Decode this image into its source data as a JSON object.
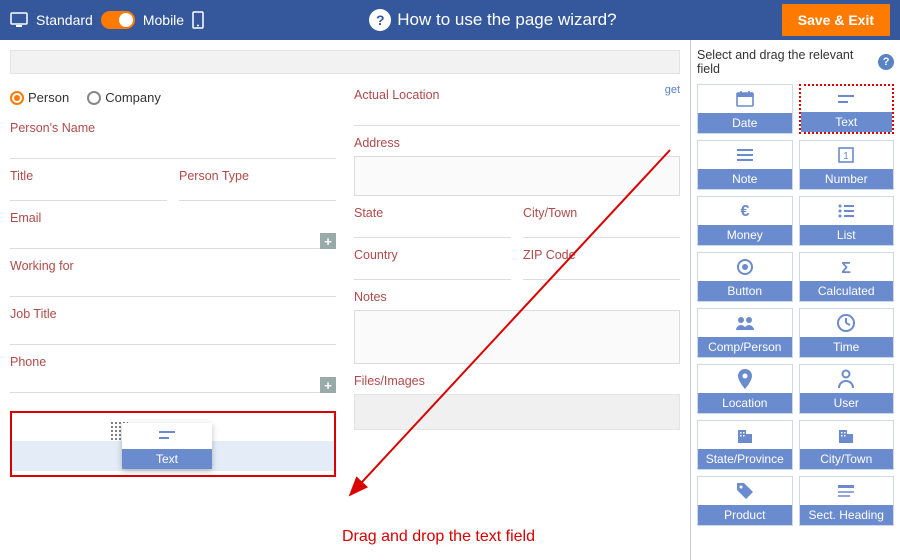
{
  "topbar": {
    "standard": "Standard",
    "mobile": "Mobile",
    "help_text": "How to use the page wizard?",
    "save_exit": "Save & Exit"
  },
  "form": {
    "radio_person": "Person",
    "radio_company": "Company",
    "persons_name": "Person's Name",
    "title": "Title",
    "person_type": "Person Type",
    "email": "Email",
    "working_for": "Working for",
    "job_title": "Job Title",
    "phone": "Phone",
    "actual_location": "Actual Location",
    "get": "get",
    "address": "Address",
    "state": "State",
    "city_town": "City/Town",
    "country": "Country",
    "zip": "ZIP Code",
    "notes": "Notes",
    "files_images": "Files/Images"
  },
  "annotation": {
    "text": "Drag and drop the text field"
  },
  "ghost": {
    "label": "Text"
  },
  "palette": {
    "header": "Select and drag the relevant field",
    "items": [
      {
        "label": "Date",
        "icon": "calendar-icon"
      },
      {
        "label": "Text",
        "icon": "text-icon",
        "highlight": true
      },
      {
        "label": "Note",
        "icon": "note-icon"
      },
      {
        "label": "Number",
        "icon": "number-icon"
      },
      {
        "label": "Money",
        "icon": "euro-icon"
      },
      {
        "label": "List",
        "icon": "list-icon"
      },
      {
        "label": "Button",
        "icon": "target-icon"
      },
      {
        "label": "Calculated",
        "icon": "sigma-icon"
      },
      {
        "label": "Comp/Person",
        "icon": "people-icon"
      },
      {
        "label": "Time",
        "icon": "clock-icon"
      },
      {
        "label": "Location",
        "icon": "pin-icon"
      },
      {
        "label": "User",
        "icon": "user-icon"
      },
      {
        "label": "State/Province",
        "icon": "building-icon"
      },
      {
        "label": "City/Town",
        "icon": "building-icon"
      },
      {
        "label": "Product",
        "icon": "tag-icon"
      },
      {
        "label": "Sect. Heading",
        "icon": "heading-icon"
      }
    ]
  }
}
